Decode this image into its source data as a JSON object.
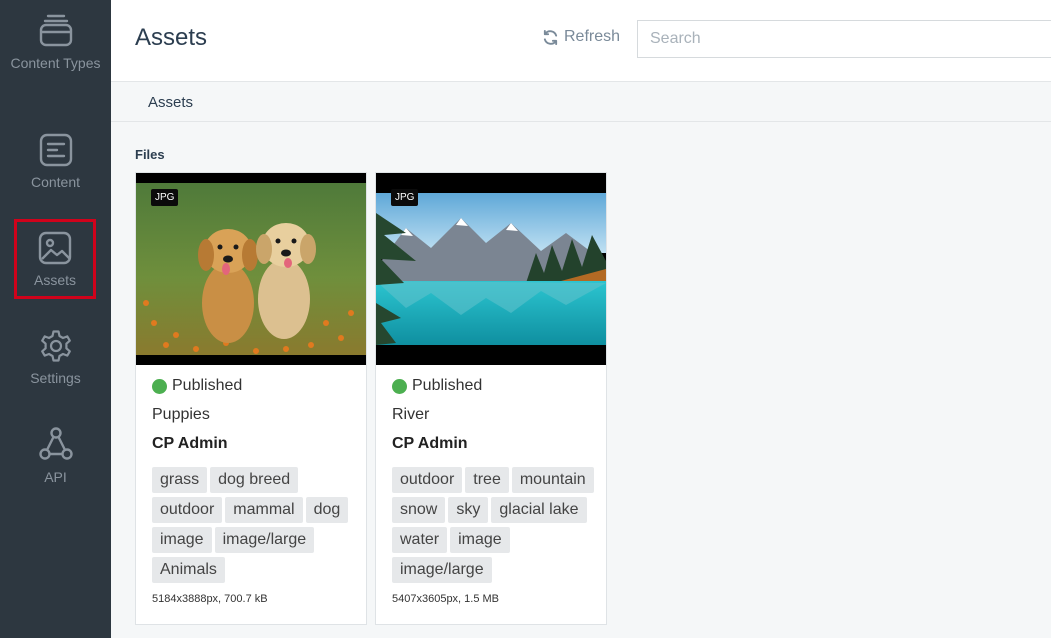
{
  "sidebar": {
    "items": [
      {
        "label": "Content Types",
        "icon": "content-types-icon"
      },
      {
        "label": "Content",
        "icon": "content-icon"
      },
      {
        "label": "Assets",
        "icon": "image-icon",
        "active": true
      },
      {
        "label": "Settings",
        "icon": "gear-icon"
      },
      {
        "label": "API",
        "icon": "api-icon"
      }
    ]
  },
  "header": {
    "title": "Assets",
    "refresh_label": "Refresh",
    "search_placeholder": "Search"
  },
  "breadcrumb": {
    "label": "Assets"
  },
  "files": {
    "label": "Files",
    "cards": [
      {
        "type_badge": "JPG",
        "status": "Published",
        "name": "Puppies",
        "owner": "CP Admin",
        "tags": [
          "grass",
          "dog breed",
          "outdoor",
          "mammal",
          "dog",
          "image",
          "image/large",
          "Animals"
        ],
        "meta": "5184x3888px, 700.7 kB"
      },
      {
        "type_badge": "JPG",
        "status": "Published",
        "name": "River",
        "owner": "CP Admin",
        "tags": [
          "outdoor",
          "tree",
          "mountain",
          "snow",
          "sky",
          "glacial lake",
          "water",
          "image",
          "image/large"
        ],
        "meta": "5407x3605px, 1.5 MB"
      }
    ]
  },
  "colors": {
    "sidebar_bg": "#2d3740",
    "active_outline": "#d0021b",
    "published": "#4caf50"
  }
}
